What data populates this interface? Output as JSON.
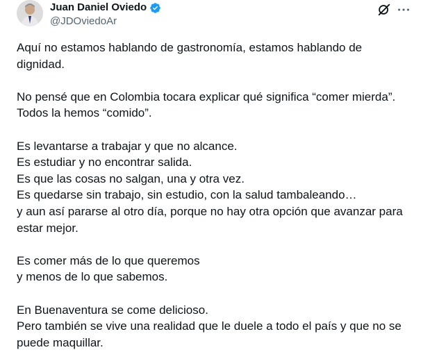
{
  "author": {
    "display_name": "Juan Daniel Oviedo",
    "handle": "@JDOviedoAr",
    "verified": true,
    "avatar_icon": "profile-photo",
    "verified_color": "#1d9bf0"
  },
  "icons": {
    "grok": "grok-icon",
    "more": "more-options-icon"
  },
  "tweet": {
    "paragraphs": [
      {
        "lines": [
          "Aquí no estamos hablando de gastronomía, estamos hablando de",
          "dignidad."
        ]
      },
      {
        "lines": [
          "No pensé que en Colombia tocara explicar qué significa “comer mierda”.",
          "Todos la hemos “comido”."
        ]
      },
      {
        "lines": [
          "Es levantarse a trabajar y que no alcance.",
          "Es estudiar y no encontrar salida.",
          "Es que las cosas no salgan, una y otra vez.",
          "Es quedarse sin trabajo, sin estudio, con la salud tambaleando…",
          "y aun así pararse al otro día, porque no hay otra opción que avanzar para",
          "estar mejor."
        ]
      },
      {
        "lines": [
          "Es comer más de lo que queremos",
          "y menos de lo que sabemos."
        ]
      },
      {
        "lines": [
          "En Buenaventura se come delicioso.",
          "Pero también se vive una realidad que le duele a todo el país y que no se",
          "puede maquillar."
        ]
      }
    ]
  }
}
